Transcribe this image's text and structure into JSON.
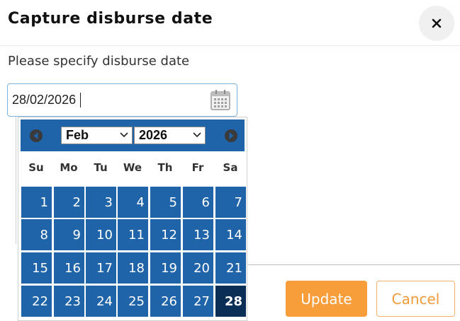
{
  "dialog": {
    "title": "Capture disburse date",
    "close_label": "×",
    "prompt": "Please specify disburse date"
  },
  "date_input": {
    "value": "28/02/2026"
  },
  "calendar": {
    "selected_month": "Feb",
    "selected_year": "2026",
    "selected_day": "28",
    "weekdays": [
      "Su",
      "Mo",
      "Tu",
      "We",
      "Th",
      "Fr",
      "Sa"
    ],
    "weeks": [
      [
        "1",
        "2",
        "3",
        "4",
        "5",
        "6",
        "7"
      ],
      [
        "8",
        "9",
        "10",
        "11",
        "12",
        "13",
        "14"
      ],
      [
        "15",
        "16",
        "17",
        "18",
        "19",
        "20",
        "21"
      ],
      [
        "22",
        "23",
        "24",
        "25",
        "26",
        "27",
        "28"
      ]
    ],
    "colors": {
      "cell": "#1f64a8",
      "selected_cell": "#0b2e57",
      "nav_button": "#3a3a3a"
    },
    "icons": {
      "prev": "circle-arrow-left-icon",
      "next": "circle-arrow-right-icon",
      "open": "calendar-icon"
    }
  },
  "actions": {
    "update_label": "Update",
    "cancel_label": "Cancel",
    "colors": {
      "update_bg": "#f79d39",
      "cancel_text": "#f09a3a"
    }
  }
}
